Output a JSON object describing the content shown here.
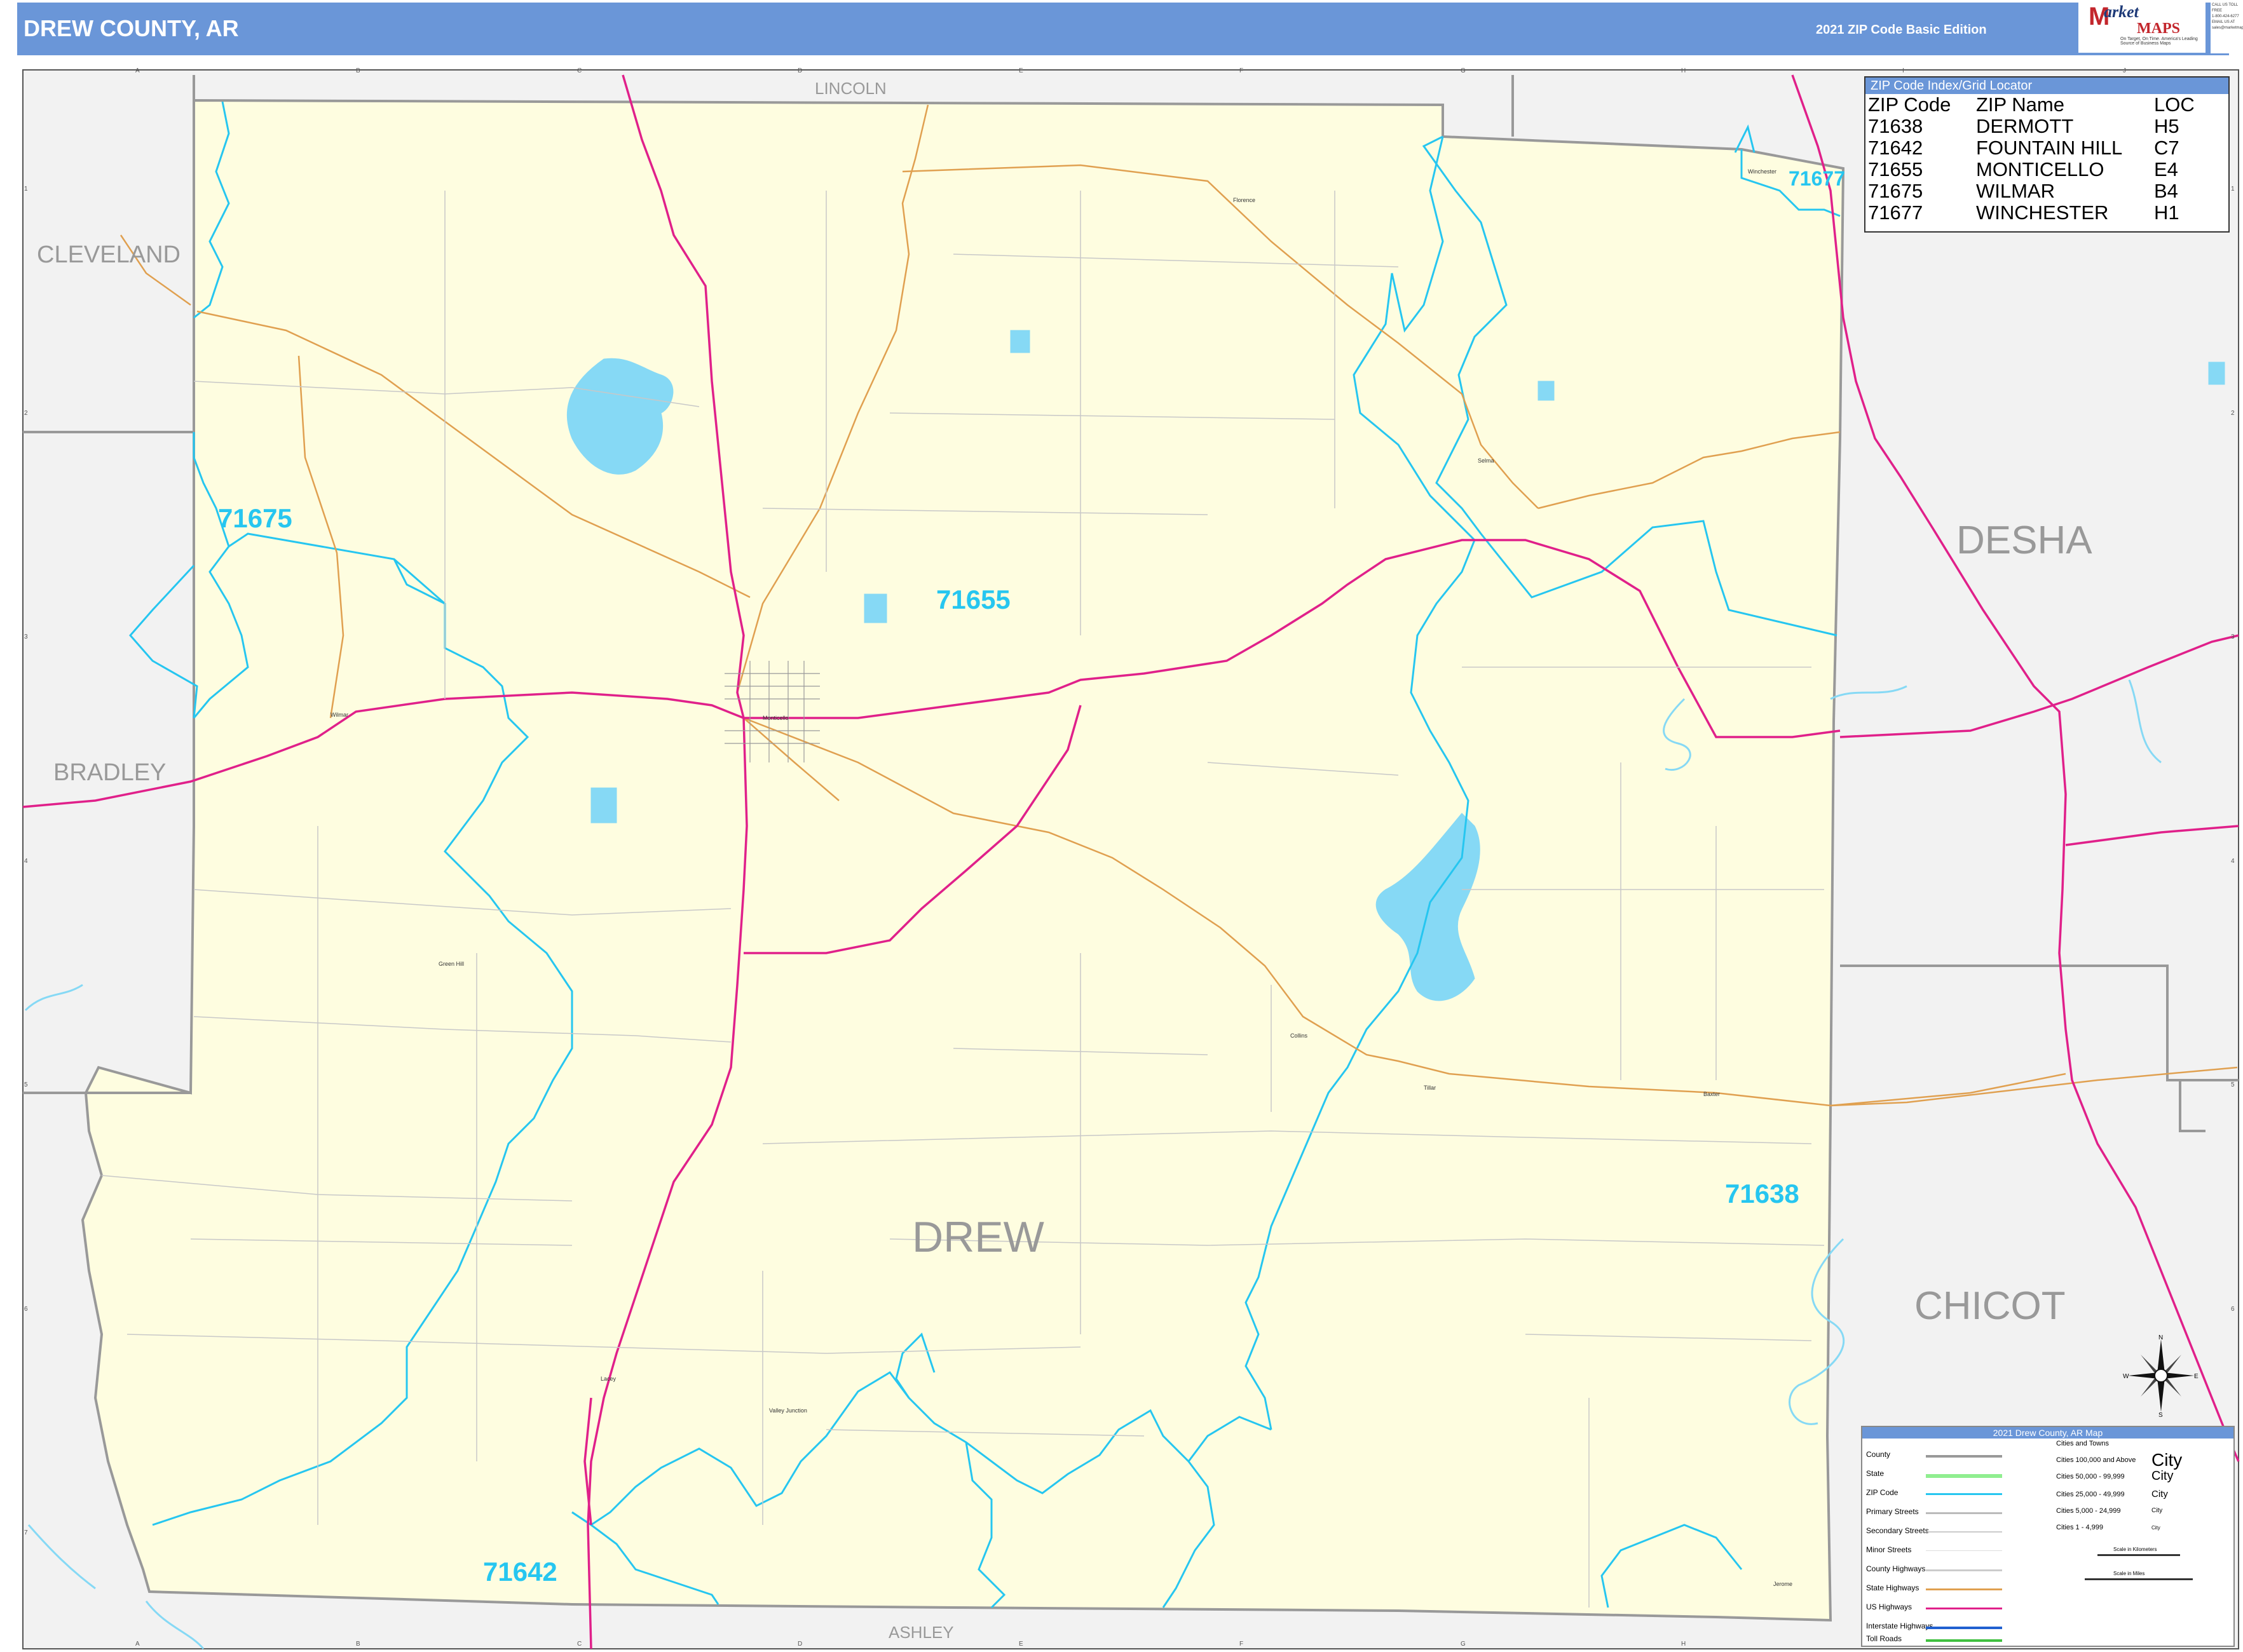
{
  "header": {
    "title": "DREW COUNTY, AR",
    "edition": "2021 ZIP Code Basic Edition"
  },
  "logo": {
    "brand_top": "arket",
    "brand_bottom": "MAPS",
    "tagline": "On Target, On Time. America's Leading Source of Business Maps",
    "contact": [
      "CALL US TOLL FREE",
      "1-800-424-6277",
      "EMAIL US AT",
      "sales@marketmaps.com"
    ]
  },
  "grid": {
    "columns": [
      "A",
      "B",
      "C",
      "D",
      "E",
      "F",
      "G",
      "H",
      "I",
      "J"
    ],
    "rows": [
      "1",
      "2",
      "3",
      "4",
      "5",
      "6",
      "7"
    ]
  },
  "map_labels": {
    "county": "DREW",
    "neighbors": [
      "LINCOLN",
      "CLEVELAND",
      "BRADLEY",
      "DESHA",
      "CHICOT",
      "ASHLEY"
    ],
    "zips": [
      "71675",
      "71655",
      "71677",
      "71638",
      "71642"
    ],
    "towns": [
      "Winchester",
      "Florence",
      "Selma",
      "Monticello",
      "Wilmar",
      "Green Hill",
      "Collins",
      "Baxter",
      "Lacey",
      "Valley Junction",
      "Jerome",
      "Tillar"
    ]
  },
  "zip_index": {
    "caption": "ZIP Code Index/Grid Locator",
    "headers": [
      "ZIP Code",
      "ZIP Name",
      "LOC"
    ],
    "rows": [
      [
        "71638",
        "DERMOTT",
        "H5"
      ],
      [
        "71642",
        "FOUNTAIN HILL",
        "C7"
      ],
      [
        "71655",
        "MONTICELLO",
        "E4"
      ],
      [
        "71675",
        "WILMAR",
        "B4"
      ],
      [
        "71677",
        "WINCHESTER",
        "H1"
      ]
    ]
  },
  "compass": {
    "n": "N",
    "s": "S",
    "e": "E",
    "w": "W"
  },
  "legend": {
    "title": "2021 Drew County, AR Map",
    "items": [
      {
        "label": "County",
        "color": "#999999"
      },
      {
        "label": "State",
        "color": "#90ee90"
      },
      {
        "label": "ZIP Code",
        "color": "#26c6f0"
      },
      {
        "label": "Primary Streets",
        "color": "#bbbbbb"
      },
      {
        "label": "Secondary Streets",
        "color": "#cccccc"
      },
      {
        "label": "Minor Streets",
        "color": "#dddddd"
      },
      {
        "label": "County Highways",
        "color": "#cccccc"
      },
      {
        "label": "State Highways",
        "color": "#e0a050"
      },
      {
        "label": "US Highways",
        "color": "#e0208a"
      },
      {
        "label": "Interstate Highways",
        "color": "#2060d0"
      },
      {
        "label": "Toll Roads",
        "color": "#40c040"
      }
    ],
    "cities_title": "Cities and Towns",
    "cities": [
      {
        "label": "Cities 100,000 and Above",
        "sample": "City"
      },
      {
        "label": "Cities 50,000 - 99,999",
        "sample": "City"
      },
      {
        "label": "Cities 25,000 - 49,999",
        "sample": "City"
      },
      {
        "label": "Cities 5,000 - 24,999",
        "sample": "City"
      },
      {
        "label": "Cities 1 - 4,999",
        "sample": "City"
      }
    ],
    "scale_km": "Scale in Kilometers",
    "scale_mi": "Scale in Miles"
  },
  "colors": {
    "header_bg": "#6a96d8",
    "county_fill": "#fefde0",
    "neighbor_fill": "#f2f2f2",
    "zip_boundary": "#26c6f0",
    "us_highway": "#e0208a",
    "state_highway": "#e0a050",
    "water": "#86d9f5"
  }
}
